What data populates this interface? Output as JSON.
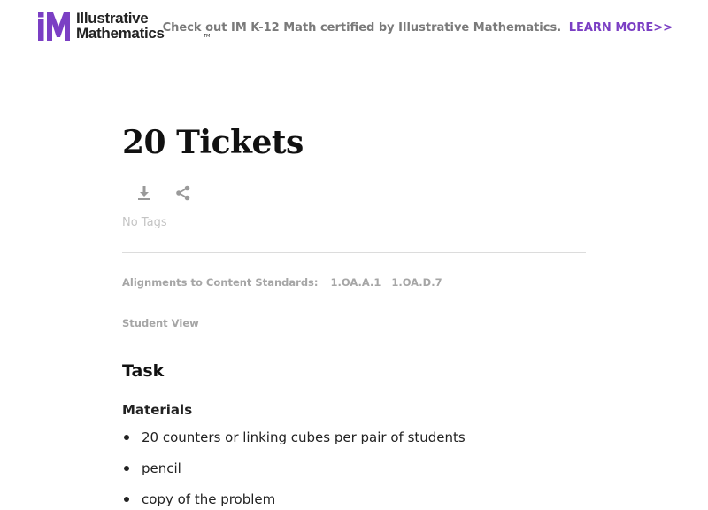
{
  "header": {
    "logo": {
      "line1": "Illustrative",
      "line2": "Mathematics",
      "tm": "TM",
      "mark_color": "#7b3fc4"
    },
    "promo": {
      "text": "Check out IM K-12 Math certified by Illustrative Mathematics.",
      "link_label": "LEARN MORE>>",
      "link_color": "#7b3fc4"
    }
  },
  "page": {
    "title": "20 Tickets",
    "actions": [
      {
        "icon": "download-icon"
      },
      {
        "icon": "share-icon"
      }
    ],
    "tags_text": "No Tags",
    "alignments": {
      "label": "Alignments to Content Standards:",
      "standards": [
        "1.OA.A.1",
        "1.OA.D.7"
      ]
    },
    "student_view_label": "Student View",
    "task_heading": "Task",
    "materials_heading": "Materials",
    "materials": [
      "20 counters or linking cubes per pair of students",
      "pencil",
      "copy of the problem"
    ]
  }
}
